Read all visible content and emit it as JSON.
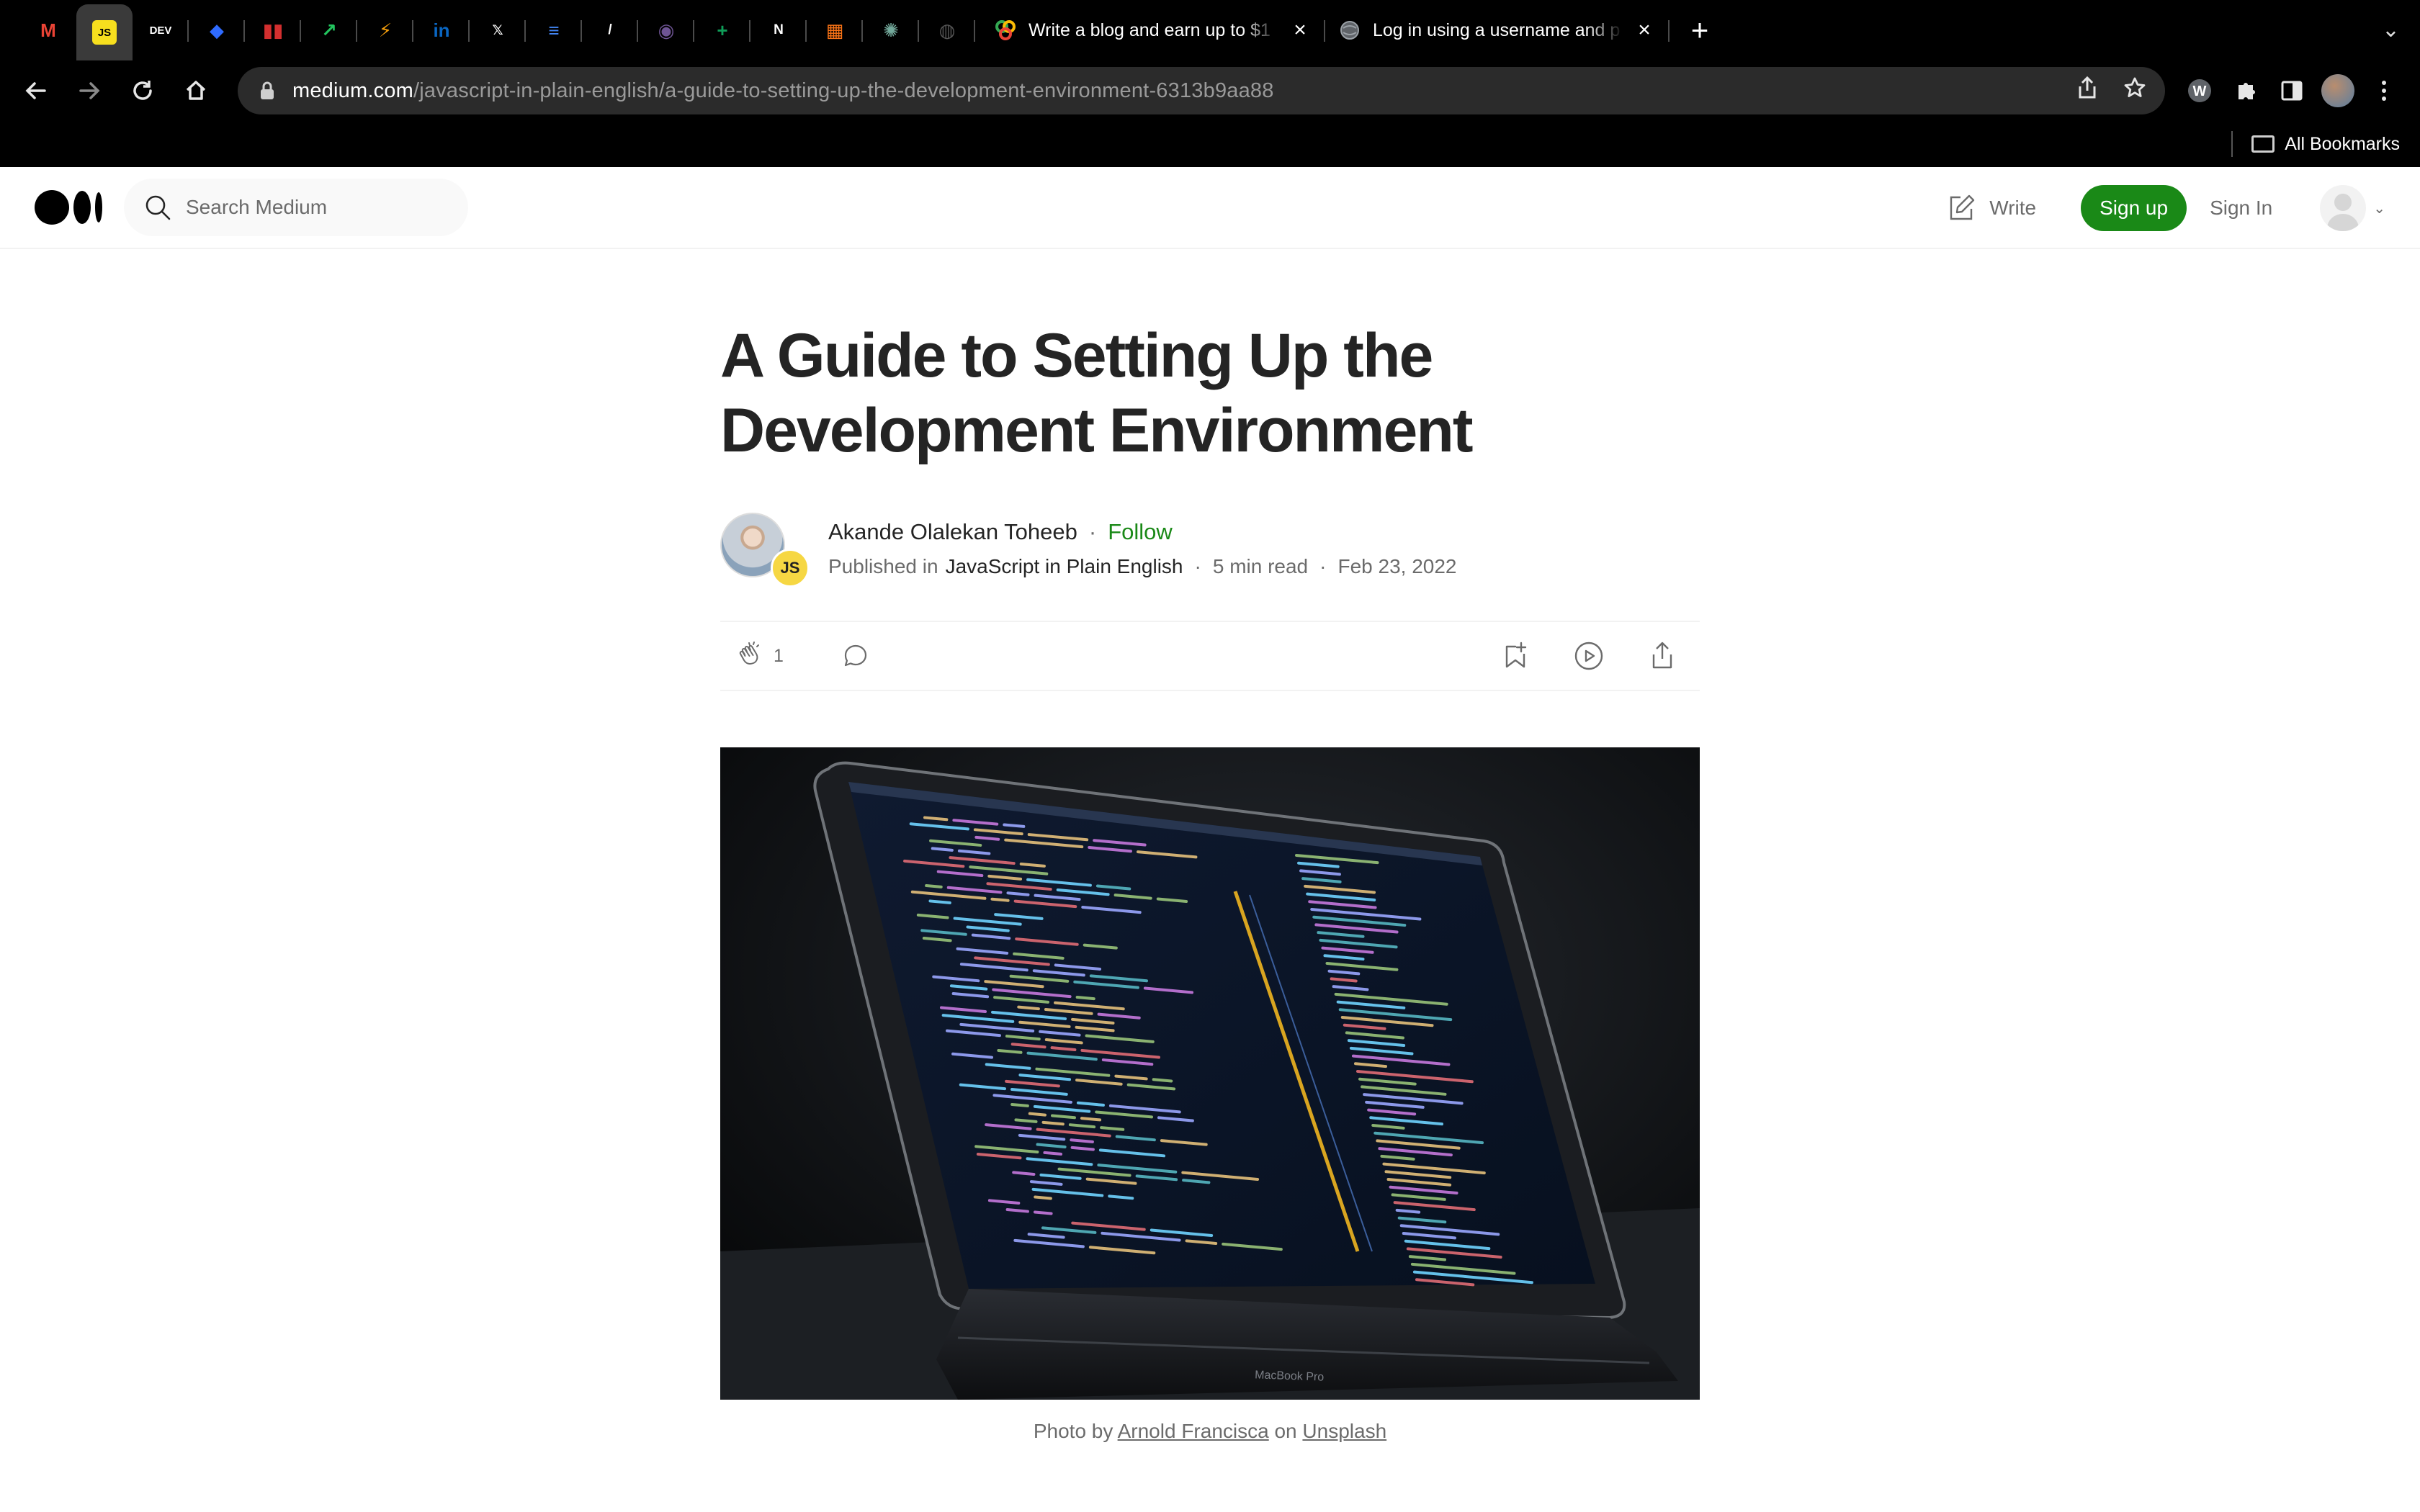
{
  "browser": {
    "pinned_tabs": [
      {
        "icon": "gmail-icon",
        "glyph": "M",
        "color": "#ea4335"
      },
      {
        "icon": "javascript-icon",
        "glyph": "JS",
        "color": "#f7df1e"
      },
      {
        "icon": "dev-icon",
        "glyph": "DEV",
        "color": "#000000"
      },
      {
        "icon": "blue-diamond-icon",
        "glyph": "◆",
        "color": "#2f6bff"
      },
      {
        "icon": "trello-icon",
        "glyph": "▮▮",
        "color": "#d32f2f"
      },
      {
        "icon": "chart-trend-icon",
        "glyph": "↗",
        "color": "#22c55e"
      },
      {
        "icon": "bolt-icon",
        "glyph": "⚡",
        "color": "#f59e0b"
      },
      {
        "icon": "linkedin-icon",
        "glyph": "in",
        "color": "#0a66c2"
      },
      {
        "icon": "x-icon",
        "glyph": "𝕏",
        "color": "#000000"
      },
      {
        "icon": "docs-icon",
        "glyph": "≡",
        "color": "#4285f4"
      },
      {
        "icon": "slash-icon",
        "glyph": "/",
        "color": "#000000"
      },
      {
        "icon": "github-icon",
        "glyph": "◉",
        "color": "#6e5494"
      },
      {
        "icon": "sheets-icon",
        "glyph": "+",
        "color": "#0f9d58"
      },
      {
        "icon": "notion-icon",
        "glyph": "N",
        "color": "#000000"
      },
      {
        "icon": "pattern-icon",
        "glyph": "▦",
        "color": "#f97316"
      },
      {
        "icon": "chatgpt-icon",
        "glyph": "✺",
        "color": "#74aa9c"
      },
      {
        "icon": "globe-icon",
        "glyph": "◍",
        "color": "#555555"
      }
    ],
    "tabs": [
      {
        "title": "Write a blog and earn up to $1",
        "icon": "colorful-logo-icon"
      },
      {
        "title": "Log in using a username and p",
        "icon": "globe-icon"
      }
    ],
    "url_host": "medium.com",
    "url_path": "/javascript-in-plain-english/a-guide-to-setting-up-the-development-environment-6313b9aa88",
    "bookmarks_label": "All Bookmarks"
  },
  "header": {
    "search_placeholder": "Search Medium",
    "write_label": "Write",
    "signup_label": "Sign up",
    "signin_label": "Sign In",
    "brand_color": "#1a8917"
  },
  "article": {
    "title": "A Guide to Setting Up the Development Environment",
    "author": "Akande Olalekan Toheeb",
    "follow_label": "Follow",
    "published_in_label": "Published in",
    "publication": "JavaScript in Plain English",
    "publication_badge": "JS",
    "read_time": "5 min read",
    "date": "Feb 23, 2022",
    "claps": "1",
    "caption_prefix": "Photo by",
    "caption_author": "Arnold Francisca",
    "caption_on": "on",
    "caption_source": "Unsplash",
    "laptop_label": "MacBook Pro"
  }
}
